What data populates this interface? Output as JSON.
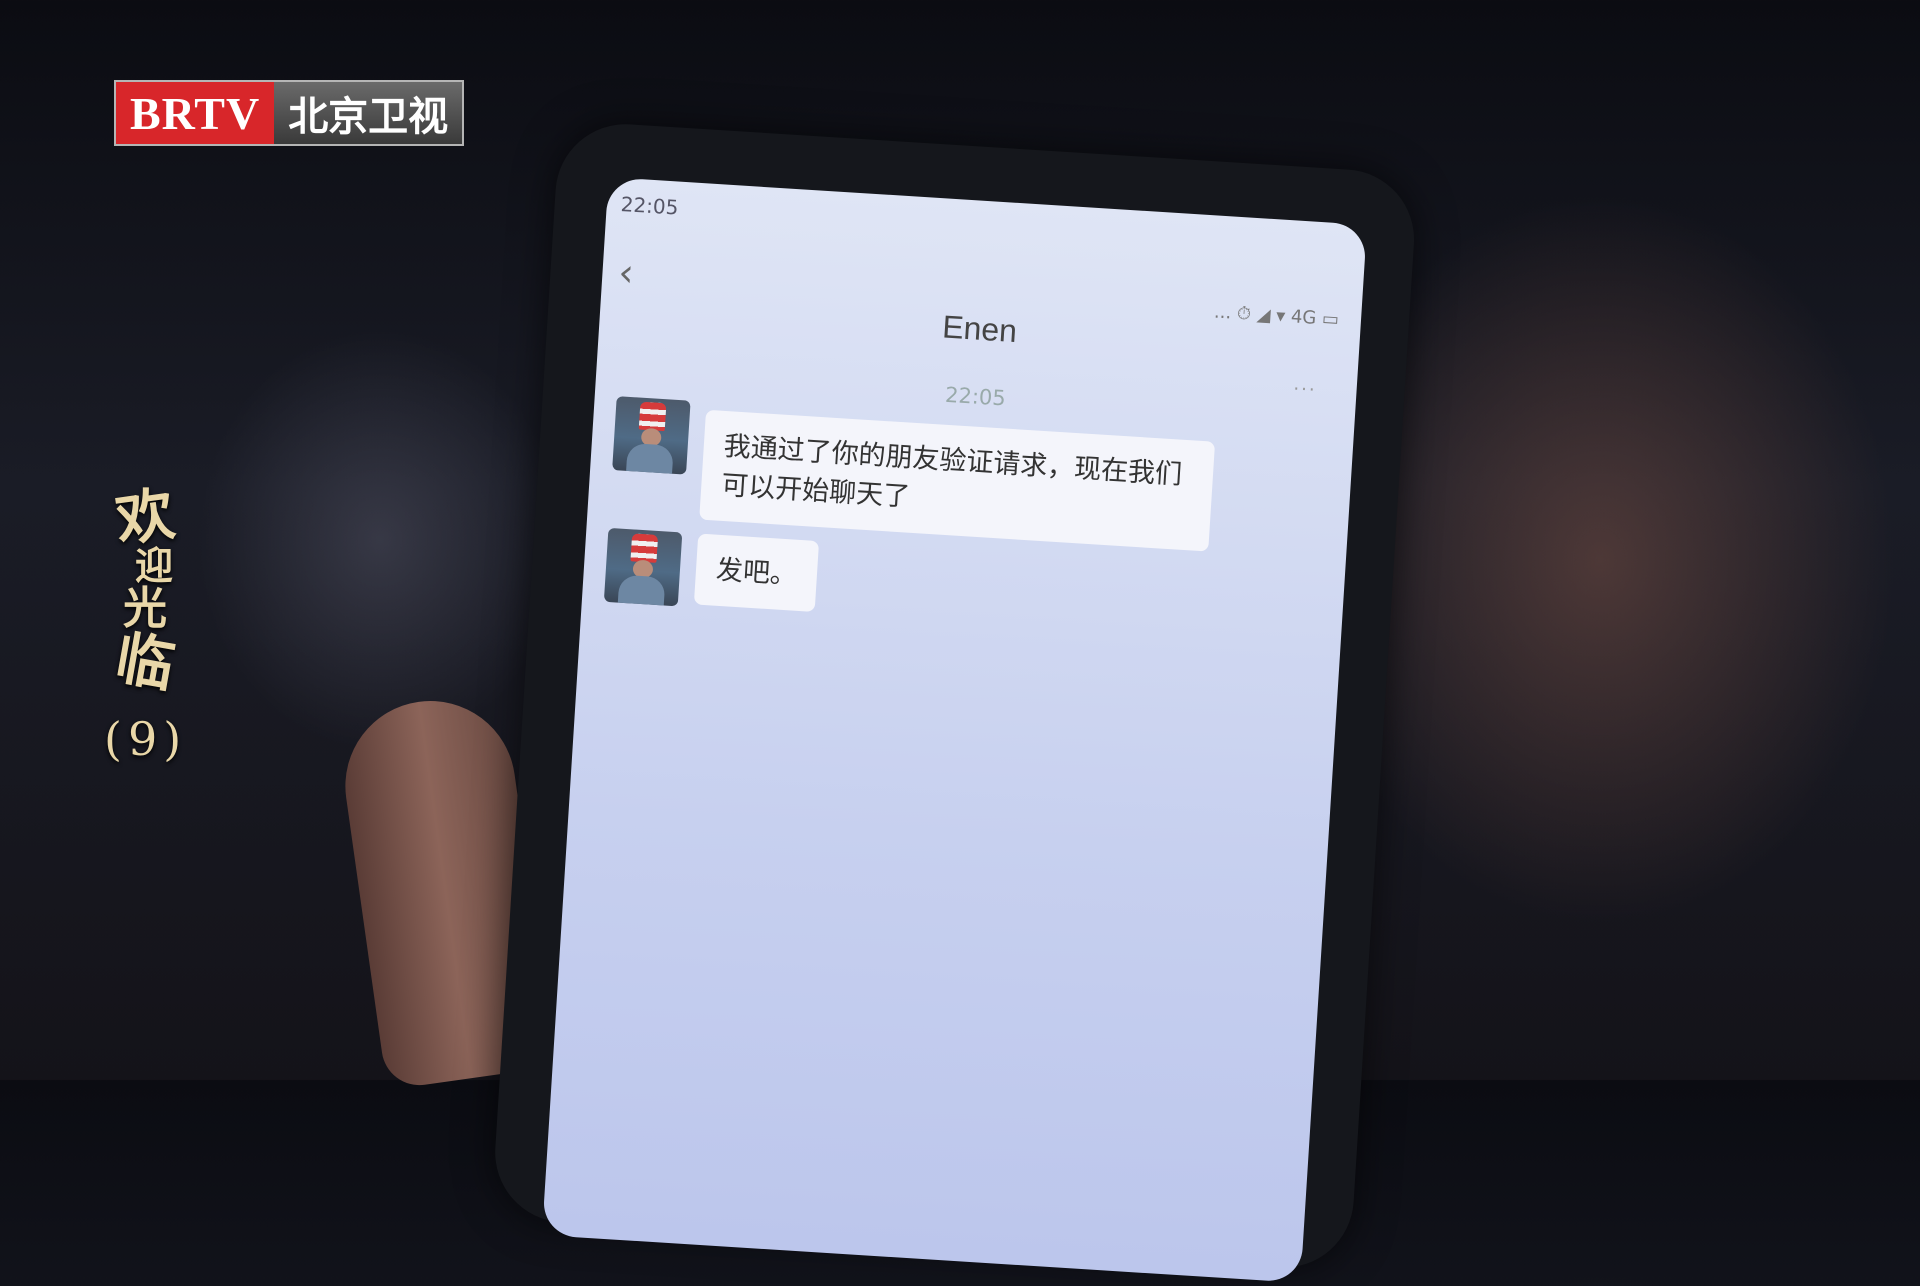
{
  "broadcaster": {
    "brand": "BRTV",
    "channel": "北京卫视"
  },
  "show": {
    "title_chars": [
      "欢",
      "迎",
      "光",
      "临"
    ],
    "episode": "(9)"
  },
  "phone": {
    "status_time": "22:05",
    "status_icons": "... ⏱ ◢ ▾ 4G ▭",
    "back_icon": "‹",
    "chat_title": "Enen",
    "more_icon": "···",
    "message_time": "22:05",
    "messages": [
      {
        "sender": "Enen",
        "text": "我通过了你的朋友验证请求，现在我们可以开始聊天了"
      },
      {
        "sender": "Enen",
        "text": "发吧。"
      }
    ]
  },
  "colors": {
    "logo_red": "#d8262a",
    "title_gold": "#e9d7a8",
    "screen_bg": "#c7d0ef"
  }
}
